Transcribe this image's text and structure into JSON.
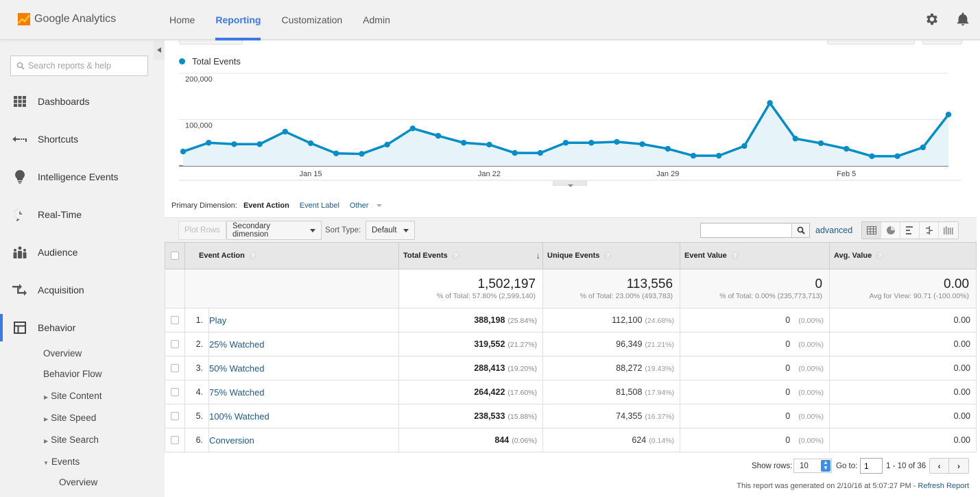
{
  "app": {
    "name": "Google Analytics"
  },
  "nav": {
    "items": [
      {
        "label": "Home",
        "active": false
      },
      {
        "label": "Reporting",
        "active": true
      },
      {
        "label": "Customization",
        "active": false
      },
      {
        "label": "Admin",
        "active": false
      }
    ],
    "icons": [
      "gear-icon",
      "bell-icon"
    ]
  },
  "sidebar": {
    "search_placeholder": "Search reports & help",
    "items": [
      {
        "label": "Dashboards",
        "icon": "dashboards-icon"
      },
      {
        "label": "Shortcuts",
        "icon": "shortcuts-icon"
      },
      {
        "label": "Intelligence Events",
        "icon": "lightbulb-icon"
      },
      {
        "label": "Real-Time",
        "icon": "clock-icon"
      },
      {
        "label": "Audience",
        "icon": "people-icon"
      },
      {
        "label": "Acquisition",
        "icon": "arrows-icon"
      },
      {
        "label": "Behavior",
        "icon": "layout-icon",
        "active": true
      }
    ],
    "behavior_sub": [
      {
        "label": "Overview"
      },
      {
        "label": "Behavior Flow"
      },
      {
        "label": "Site Content",
        "expandable": true,
        "expanded": false
      },
      {
        "label": "Site Speed",
        "expandable": true,
        "expanded": false
      },
      {
        "label": "Site Search",
        "expandable": true,
        "expanded": false
      },
      {
        "label": "Events",
        "expandable": true,
        "expanded": true
      }
    ],
    "events_sub": [
      {
        "label": "Overview"
      }
    ]
  },
  "chart_data": {
    "type": "area",
    "title": "",
    "legend": [
      "Total Events"
    ],
    "legend_placement": "top-left",
    "series": [
      {
        "name": "Total Events",
        "color": "#058dc7",
        "values": [
          31000,
          50000,
          47000,
          47000,
          74000,
          49000,
          27000,
          26000,
          46000,
          81000,
          65000,
          50000,
          46000,
          28000,
          28000,
          50000,
          50000,
          52000,
          47000,
          37000,
          22000,
          22000,
          43000,
          136000,
          59000,
          49000,
          37000,
          21000,
          21000,
          40000,
          111000
        ]
      }
    ],
    "x": [
      "Jan 10",
      "Jan 11",
      "Jan 12",
      "Jan 13",
      "Jan 14",
      "Jan 15",
      "Jan 16",
      "Jan 17",
      "Jan 18",
      "Jan 19",
      "Jan 20",
      "Jan 21",
      "Jan 22",
      "Jan 23",
      "Jan 24",
      "Jan 25",
      "Jan 26",
      "Jan 27",
      "Jan 28",
      "Jan 29",
      "Jan 30",
      "Jan 31",
      "Feb 1",
      "Feb 2",
      "Feb 3",
      "Feb 4",
      "Feb 5",
      "Feb 6",
      "Feb 7",
      "Feb 8",
      "Feb 9"
    ],
    "x_tick_labels": [
      "Jan 15",
      "Jan 22",
      "Jan 29",
      "Feb 5"
    ],
    "y_tick_labels": [
      "100,000",
      "200,000"
    ],
    "y_ticks": [
      100000,
      200000
    ],
    "ylim": [
      0,
      200000
    ],
    "grid": true,
    "xlabel": "",
    "ylabel": ""
  },
  "primary_dimension": {
    "label": "Primary Dimension:",
    "current": "Event Action",
    "options": [
      "Event Label",
      "Other"
    ]
  },
  "toolbar": {
    "plot_rows": "Plot Rows",
    "secondary_dimension": "Secondary dimension",
    "sort_type_label": "Sort Type:",
    "sort_type_value": "Default",
    "search_value": "",
    "advanced": "advanced",
    "view_buttons": [
      "table-view-icon",
      "pie-view-icon",
      "bar-view-icon",
      "comparison-view-icon",
      "pivot-view-icon"
    ]
  },
  "table": {
    "headers": [
      "Event Action",
      "Total Events",
      "Unique Events",
      "Event Value",
      "Avg. Value"
    ],
    "sorted_by": "Total Events",
    "totals": {
      "total_events": "1,502,197",
      "total_events_sub": "% of Total: 57.80% (2,599,140)",
      "unique_events": "113,556",
      "unique_events_sub": "% of Total: 23.00% (493,783)",
      "event_value": "0",
      "event_value_sub": "% of Total: 0.00% (235,773,713)",
      "avg_value": "0.00",
      "avg_value_sub": "Avg for View: 90.71 (-100.00%)"
    },
    "rows": [
      {
        "idx": "1.",
        "name": "Play",
        "total": "388,198",
        "total_pct": "(25.84%)",
        "unique": "112,100",
        "unique_pct": "(24.68%)",
        "value": "0",
        "value_pct": "(0.00%)",
        "avg": "0.00"
      },
      {
        "idx": "2.",
        "name": "25% Watched",
        "total": "319,552",
        "total_pct": "(21.27%)",
        "unique": "96,349",
        "unique_pct": "(21.21%)",
        "value": "0",
        "value_pct": "(0.00%)",
        "avg": "0.00"
      },
      {
        "idx": "3.",
        "name": "50% Watched",
        "total": "288,413",
        "total_pct": "(19.20%)",
        "unique": "88,272",
        "unique_pct": "(19.43%)",
        "value": "0",
        "value_pct": "(0.00%)",
        "avg": "0.00"
      },
      {
        "idx": "4.",
        "name": "75% Watched",
        "total": "264,422",
        "total_pct": "(17.60%)",
        "unique": "81,508",
        "unique_pct": "(17.94%)",
        "value": "0",
        "value_pct": "(0.00%)",
        "avg": "0.00"
      },
      {
        "idx": "5.",
        "name": "100% Watched",
        "total": "238,533",
        "total_pct": "(15.88%)",
        "unique": "74,355",
        "unique_pct": "(16.37%)",
        "value": "0",
        "value_pct": "(0.00%)",
        "avg": "0.00"
      },
      {
        "idx": "6.",
        "name": "Conversion",
        "total": "844",
        "total_pct": "(0.06%)",
        "unique": "624",
        "unique_pct": "(0.14%)",
        "value": "0",
        "value_pct": "(0.00%)",
        "avg": "0.00"
      }
    ]
  },
  "pager": {
    "show_rows_label": "Show rows:",
    "show_rows_value": "10",
    "goto_label": "Go to:",
    "goto_value": "1",
    "range": "1 - 10 of 36"
  },
  "footer": {
    "generated": "This report was generated on 2/10/16 at 5:07:27 PM - ",
    "refresh": "Refresh Report"
  }
}
